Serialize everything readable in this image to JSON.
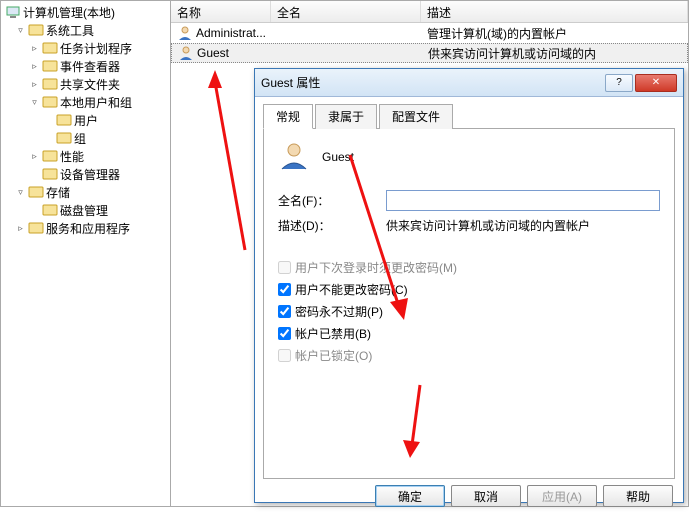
{
  "tree": {
    "root": "计算机管理(本地)",
    "items": [
      {
        "label": "系统工具",
        "depth": 1,
        "icon": "tools",
        "exp": "▿"
      },
      {
        "label": "任务计划程序",
        "depth": 2,
        "icon": "clock",
        "exp": "▹"
      },
      {
        "label": "事件查看器",
        "depth": 2,
        "icon": "event",
        "exp": "▹"
      },
      {
        "label": "共享文件夹",
        "depth": 2,
        "icon": "share",
        "exp": "▹"
      },
      {
        "label": "本地用户和组",
        "depth": 2,
        "icon": "users",
        "exp": "▿"
      },
      {
        "label": "用户",
        "depth": 3,
        "icon": "folder",
        "exp": ""
      },
      {
        "label": "组",
        "depth": 3,
        "icon": "folder",
        "exp": ""
      },
      {
        "label": "性能",
        "depth": 2,
        "icon": "perf",
        "exp": "▹"
      },
      {
        "label": "设备管理器",
        "depth": 2,
        "icon": "device",
        "exp": ""
      },
      {
        "label": "存储",
        "depth": 1,
        "icon": "storage",
        "exp": "▿"
      },
      {
        "label": "磁盘管理",
        "depth": 2,
        "icon": "disk",
        "exp": ""
      },
      {
        "label": "服务和应用程序",
        "depth": 1,
        "icon": "services",
        "exp": "▹"
      }
    ]
  },
  "list": {
    "columns": {
      "name": "名称",
      "fullname": "全名",
      "desc": "描述"
    },
    "rows": [
      {
        "name": "Administrat...",
        "fullname": "",
        "desc": "管理计算机(域)的内置帐户"
      },
      {
        "name": "Guest",
        "fullname": "",
        "desc": "供来宾访问计算机或访问域的内"
      }
    ]
  },
  "dialog": {
    "title": "Guest 属性",
    "tabs": [
      "常规",
      "隶属于",
      "配置文件"
    ],
    "username": "Guest",
    "fields": {
      "fullname_label": "全名(F)：",
      "fullname_value": "",
      "desc_label": "描述(D)：",
      "desc_value": "供来宾访问计算机或访问域的内置帐户"
    },
    "checks": [
      {
        "label": "用户下次登录时须更改密码(M)",
        "checked": false,
        "enabled": false
      },
      {
        "label": "用户不能更改密码(C)",
        "checked": true,
        "enabled": true
      },
      {
        "label": "密码永不过期(P)",
        "checked": true,
        "enabled": true
      },
      {
        "label": "帐户已禁用(B)",
        "checked": true,
        "enabled": true
      },
      {
        "label": "帐户已锁定(O)",
        "checked": false,
        "enabled": false
      }
    ],
    "buttons": {
      "ok": "确定",
      "cancel": "取消",
      "apply": "应用(A)",
      "help": "帮助"
    }
  }
}
